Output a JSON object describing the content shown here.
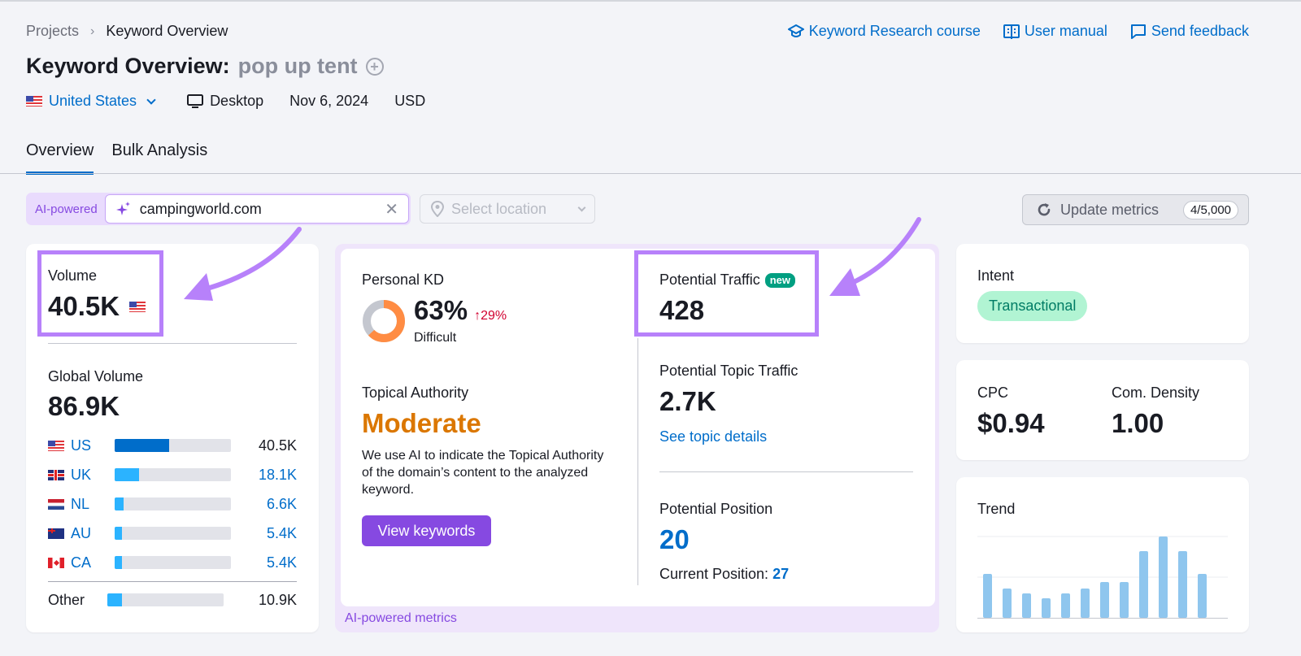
{
  "breadcrumb": {
    "parent": "Projects",
    "separator": "›",
    "current": "Keyword Overview"
  },
  "header": {
    "title_prefix": "Keyword Overview:",
    "keyword": "pop up tent",
    "add_icon": "plus-circle-icon",
    "country": "United States",
    "device": "Desktop",
    "date": "Nov 6, 2024",
    "currency": "USD"
  },
  "top_links": [
    {
      "label": "Keyword Research course",
      "icon": "graduation-cap-icon"
    },
    {
      "label": "User manual",
      "icon": "book-icon"
    },
    {
      "label": "Send feedback",
      "icon": "chat-bubble-icon"
    }
  ],
  "tabs": [
    {
      "label": "Overview",
      "active": true
    },
    {
      "label": "Bulk Analysis",
      "active": false
    }
  ],
  "search": {
    "ai_label": "AI-powered",
    "domain_value": "campingworld.com",
    "location_placeholder": "Select location"
  },
  "update": {
    "label": "Update metrics",
    "count": "4/5,000"
  },
  "volume": {
    "label": "Volume",
    "value": "40.5K",
    "global_label": "Global Volume",
    "global_value": "86.9K",
    "countries": [
      {
        "code": "US",
        "flag": "us",
        "value": "40.5K",
        "share": 0.47
      },
      {
        "code": "UK",
        "flag": "uk",
        "value": "18.1K",
        "share": 0.21
      },
      {
        "code": "NL",
        "flag": "nl",
        "value": "6.6K",
        "share": 0.076
      },
      {
        "code": "AU",
        "flag": "au",
        "value": "5.4K",
        "share": 0.062
      },
      {
        "code": "CA",
        "flag": "ca",
        "value": "5.4K",
        "share": 0.062
      }
    ],
    "other": {
      "label": "Other",
      "value": "10.9K",
      "share": 0.125
    }
  },
  "ai_metrics": {
    "footer": "AI-powered metrics",
    "personal_kd": {
      "label": "Personal KD",
      "value": "63%",
      "percent": 63,
      "delta": "↑29%",
      "level": "Difficult"
    },
    "topical_authority": {
      "label": "Topical Authority",
      "value": "Moderate",
      "description": "We use AI to indicate the Topical Authority of the domain’s content to the analyzed keyword.",
      "button": "View keywords"
    },
    "potential_traffic": {
      "label": "Potential Traffic",
      "badge": "new",
      "value": "428"
    },
    "potential_topic_traffic": {
      "label": "Potential Topic Traffic",
      "value": "2.7K",
      "link": "See topic details"
    },
    "potential_position": {
      "label": "Potential Position",
      "value": "20",
      "current_label": "Current Position:",
      "current_value": "27"
    }
  },
  "intent": {
    "label": "Intent",
    "value": "Transactional"
  },
  "cpc": {
    "label": "CPC",
    "value": "$0.94"
  },
  "com_density": {
    "label": "Com. Density",
    "value": "1.00"
  },
  "trend": {
    "label": "Trend",
    "values": [
      0.54,
      0.36,
      0.3,
      0.24,
      0.3,
      0.36,
      0.44,
      0.44,
      0.82,
      1.0,
      0.82,
      0.54
    ]
  },
  "colors": {
    "accent_blue": "#006dca",
    "ai_purple": "#8649e1",
    "highlight_box": "#b781fa",
    "kd_orange": "#ff8c43",
    "authority_orange": "#db7700",
    "intent_green_bg": "#b1f4d3",
    "trend_bar": "#8fc6ee"
  }
}
